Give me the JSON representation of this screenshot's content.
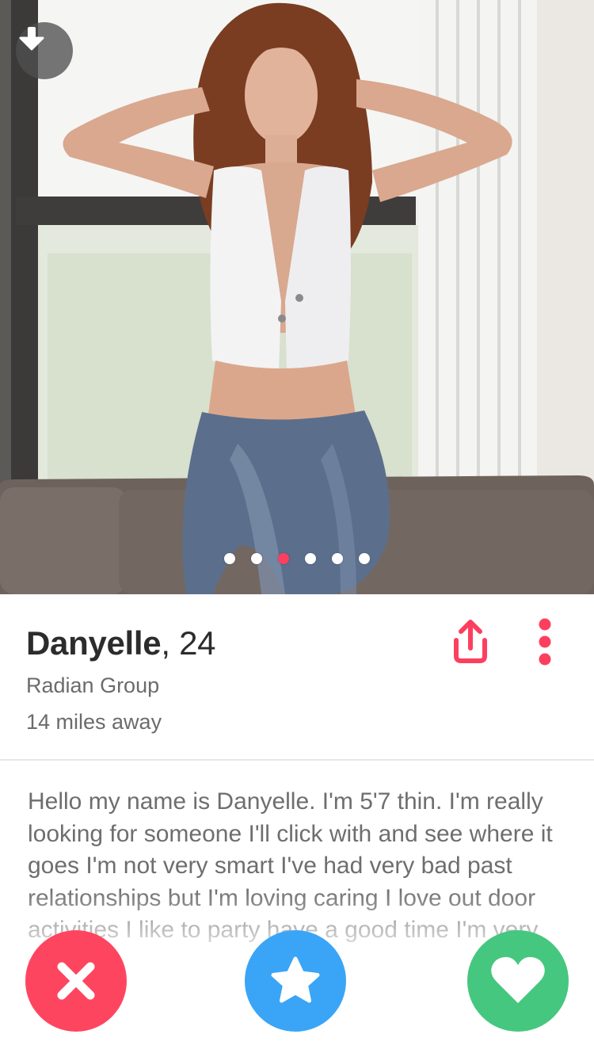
{
  "profile": {
    "name": "Danyelle",
    "age_text": ", 24",
    "work": "Radian Group",
    "distance": "14 miles away",
    "bio": "Hello my name is Danyelle. I'm 5'7 thin. I'm really looking for someone I'll click with and see where it goes I'm not very smart I've had very bad past relationships but I'm loving caring I love out door activities I like to party have a good time I'm very outgoing"
  },
  "photo": {
    "image_count": 6,
    "active_index": 2
  },
  "icons": {
    "collapse": "arrow-down-icon",
    "share": "share-icon",
    "more": "more-vertical-icon",
    "nope": "close-icon",
    "super_like": "star-icon",
    "like": "heart-icon"
  },
  "colors": {
    "accent": "#fd3f5f",
    "nope": "#fe4560",
    "super_like": "#3aa5f6",
    "like": "#45c77f"
  }
}
